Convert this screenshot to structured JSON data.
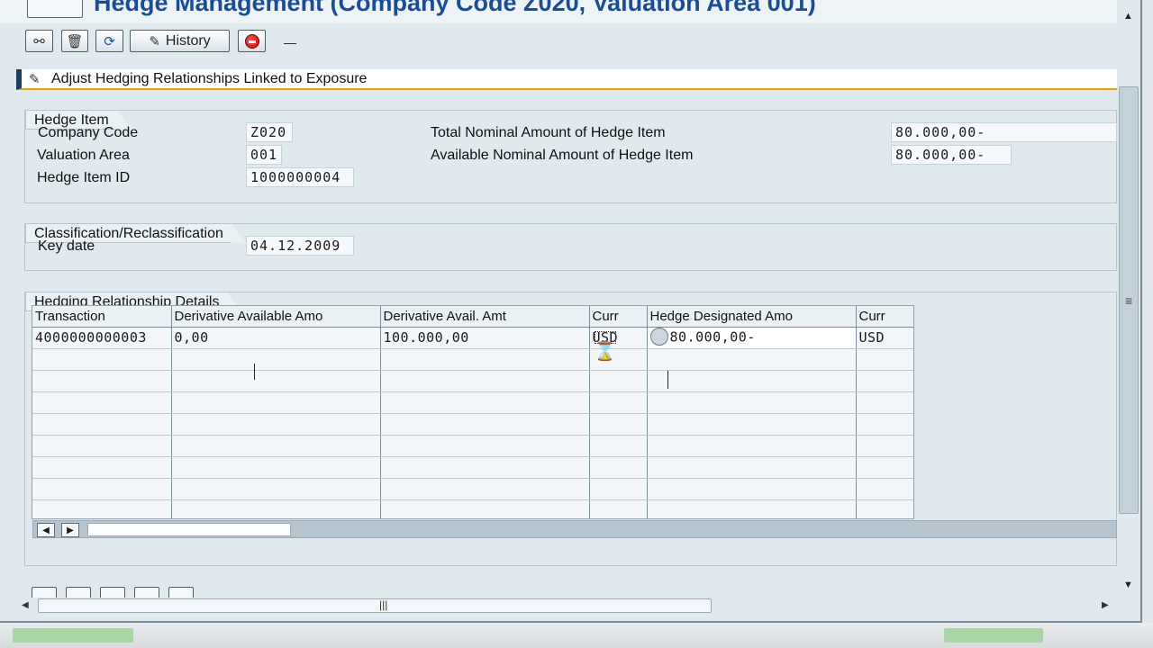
{
  "window": {
    "title": "Hedge Management (Company Code Z020, Valuation Area 001)"
  },
  "toolbar": {
    "history_label": "History",
    "icons": [
      "glasses-icon",
      "trash-icon",
      "refresh-icon",
      "history-icon",
      "cancel-icon"
    ]
  },
  "section_header": {
    "title": "Adjust Hedging Relationships Linked to Exposure"
  },
  "hedge_item": {
    "group_title": "Hedge Item",
    "company_code_label": "Company Code",
    "company_code_value": "Z020",
    "valuation_area_label": "Valuation Area",
    "valuation_area_value": "001",
    "hedge_item_id_label": "Hedge Item ID",
    "hedge_item_id_value": "1000000004",
    "total_nominal_label": "Total Nominal Amount of Hedge Item",
    "total_nominal_value": "80.000,00-",
    "available_nominal_label": "Available Nominal Amount of Hedge Item",
    "available_nominal_value": "80.000,00-"
  },
  "classification": {
    "group_title": "Classification/Reclassification",
    "key_date_label": "Key date",
    "key_date_value": "04.12.2009"
  },
  "details": {
    "group_title": "Hedging Relationship Details",
    "columns": [
      "Transaction",
      "Derivative Available Amo",
      "Derivative Avail. Amt",
      "Curr",
      "Hedge Designated Amo",
      "Curr"
    ],
    "rows": [
      [
        "4000000000003",
        "0,00",
        "100.000,00",
        "USD",
        "80.000,00-",
        "USD"
      ]
    ],
    "empty_rows": 8
  },
  "colors": {
    "title_blue": "#1a4c9c",
    "header_accent": "#f0a000",
    "panel_bg": "#dfe9ee"
  }
}
